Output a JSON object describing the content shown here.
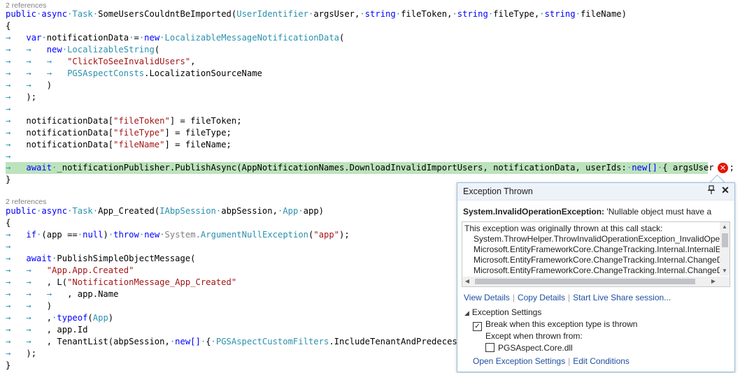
{
  "editor": {
    "method1": {
      "references": "2 references",
      "signature": {
        "public": "public",
        "async": "async",
        "task": "Task",
        "name": "SomeUsersCouldntBeImported(",
        "t1": "UserIdentifier",
        "p1": "argsUser,",
        "t2": "string",
        "p2": "fileToken,",
        "t3": "string",
        "p3": "fileType,",
        "t4": "string",
        "p4": "fileName)"
      },
      "open_brace": "{",
      "l1_var": "var",
      "l1_mid": "notificationData",
      "l1_eq": "=",
      "l1_new": "new",
      "l1_type": "LocalizableMessageNotificationData",
      "l1_paren": "(",
      "l2_new": "new",
      "l2_type": "LocalizableString",
      "l2_paren": "(",
      "l3_str": "\"ClickToSeeInvalidUsers\"",
      "l3_comma": ",",
      "l4_type": "PGSAspectConsts",
      "l4_rest": ".LocalizationSourceName",
      "l5": ")",
      "l6": ");",
      "l7_a": "notificationData[",
      "l7_s": "\"fileToken\"",
      "l7_b": "] = fileToken;",
      "l8_a": "notificationData[",
      "l8_s": "\"fileType\"",
      "l8_b": "] = fileType;",
      "l9_a": "notificationData[",
      "l9_s": "\"fileName\"",
      "l9_b": "] = fileName;",
      "l10_await": "await",
      "l10_a": "_notificationPublisher.PublishAsync(AppNotificationNames.DownloadInvalidImportUsers, notificationData, userIds:",
      "l10_new": "new[]",
      "l10_b": "{ argsUser });",
      "close_brace": "}"
    },
    "method2": {
      "references": "2 references",
      "public": "public",
      "async": "async",
      "task": "Task",
      "name": "App_Created(",
      "t1": "IAbpSession",
      "p1": "abpSession,",
      "t2": "App",
      "p2": "app)",
      "open_brace": "{",
      "if": "if",
      "if_mid": "(app ==",
      "null": "null",
      "if_paren": ")",
      "throw": "throw",
      "new": "new",
      "sys": "System.",
      "ex": "ArgumentNullException",
      "ex_open": "(",
      "ex_str": "\"app\"",
      "ex_close": ");",
      "await": "await",
      "publish": "PublishSimpleObjectMessage(",
      "str1": "\"App.App.Created\"",
      "l_a": ", L(",
      "str2": "\"NotificationMessage_App_Created\"",
      "appname": ", app.Name",
      "close1": ")",
      "typeof_pre": ",",
      "typeof": "typeof",
      "typeof_open": "(",
      "typeof_arg": "App",
      "typeof_close": ")",
      "appid": ", app.Id",
      "tenant_a": ", TenantList(abpSession,",
      "tenant_new": "new[]",
      "tenant_b": "{",
      "tenant_type": "PGSAspectCustomFilters",
      "tenant_c": ".IncludeTenantAndPredecessor",
      "close2": ");",
      "close_brace": "}"
    }
  },
  "popup": {
    "title": "Exception Thrown",
    "pin_icon": "pin-icon",
    "close_icon": "close-icon",
    "exception_type": "System.InvalidOperationException:",
    "exception_message": "'Nullable object must have a",
    "stack_intro": "This exception was originally thrown at this call stack:",
    "frames": [
      "System.ThrowHelper.ThrowInvalidOperationException_InvalidOper",
      "Microsoft.EntityFrameworkCore.ChangeTracking.Internal.InternalEr",
      "Microsoft.EntityFrameworkCore.ChangeTracking.Internal.ChangeDe",
      "Microsoft.EntityFrameworkCore.ChangeTracking.Internal.ChangeDe"
    ],
    "links": {
      "view_details": "View Details",
      "copy_details": "Copy Details",
      "live_share": "Start Live Share session..."
    },
    "settings": {
      "header": "Exception Settings",
      "break_label": "Break when this exception type is thrown",
      "break_checked": true,
      "except_label": "Except when thrown from:",
      "module_label": "PGSAspect.Core.dll",
      "module_checked": false
    },
    "bottom_links": {
      "open_settings": "Open Exception Settings",
      "edit_conditions": "Edit Conditions"
    }
  }
}
